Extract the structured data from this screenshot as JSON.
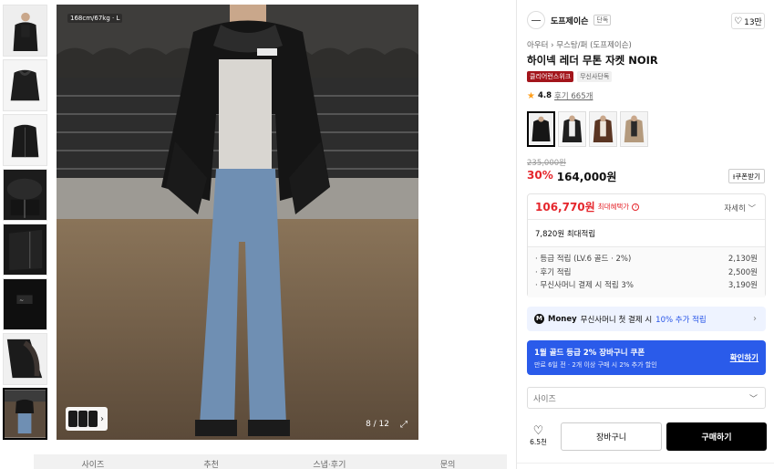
{
  "gallery": {
    "size_overlay": "168cm/67kg · L",
    "counter": "8 / 12",
    "thumb_count": 8
  },
  "bottom_tabs": [
    "사이즈",
    "추천",
    "스냅·후기",
    "문의"
  ],
  "brand": {
    "name": "도프제이슨",
    "badge": "단독",
    "likes": "13만"
  },
  "breadcrumb": "아우터 › 무스탕/퍼 (도프제이슨)",
  "product": {
    "title": "하이넥 레더 무톤 자켓 NOIR",
    "tag_1": "클리어런스위크",
    "tag_2": "무신사단독",
    "rating": "4.8",
    "reviews": "후기 665개",
    "original_price": "235,000원",
    "discount": "30%",
    "price": "164,000원",
    "coupon_label": "쿠폰받기"
  },
  "benefit": {
    "price": "106,770원",
    "label": "최대혜택가",
    "detail": "자세히",
    "points_total": "7,820원 최대적립",
    "rows": [
      {
        "label": "· 등급 적립 (LV.6 골드 · 2%)",
        "value": "2,130원"
      },
      {
        "label": "· 후기 적립",
        "value": "2,500원"
      },
      {
        "label": "· 무신사머니 결제 시 적립 3%",
        "value": "3,190원"
      }
    ]
  },
  "money_bar": {
    "icon": "M",
    "brand": "Money",
    "text": "무신사머니 첫 결제 시",
    "highlight": "10% 추가 적립"
  },
  "promo": {
    "title": "1월 골드 등급 2% 장바구니 쿠폰",
    "subtitle": "만료 6일 전 · 2개 이상 구매 시 2% 추가 할인",
    "button": "확인하기"
  },
  "size_select": {
    "placeholder": "사이즈"
  },
  "actions": {
    "wish_count": "6.5천",
    "cart": "장바구니",
    "buy": "구매하기"
  },
  "colors": {
    "accent_red": "#e5262c",
    "promo_blue": "#2a5bea",
    "tag_red": "#a3151b"
  }
}
